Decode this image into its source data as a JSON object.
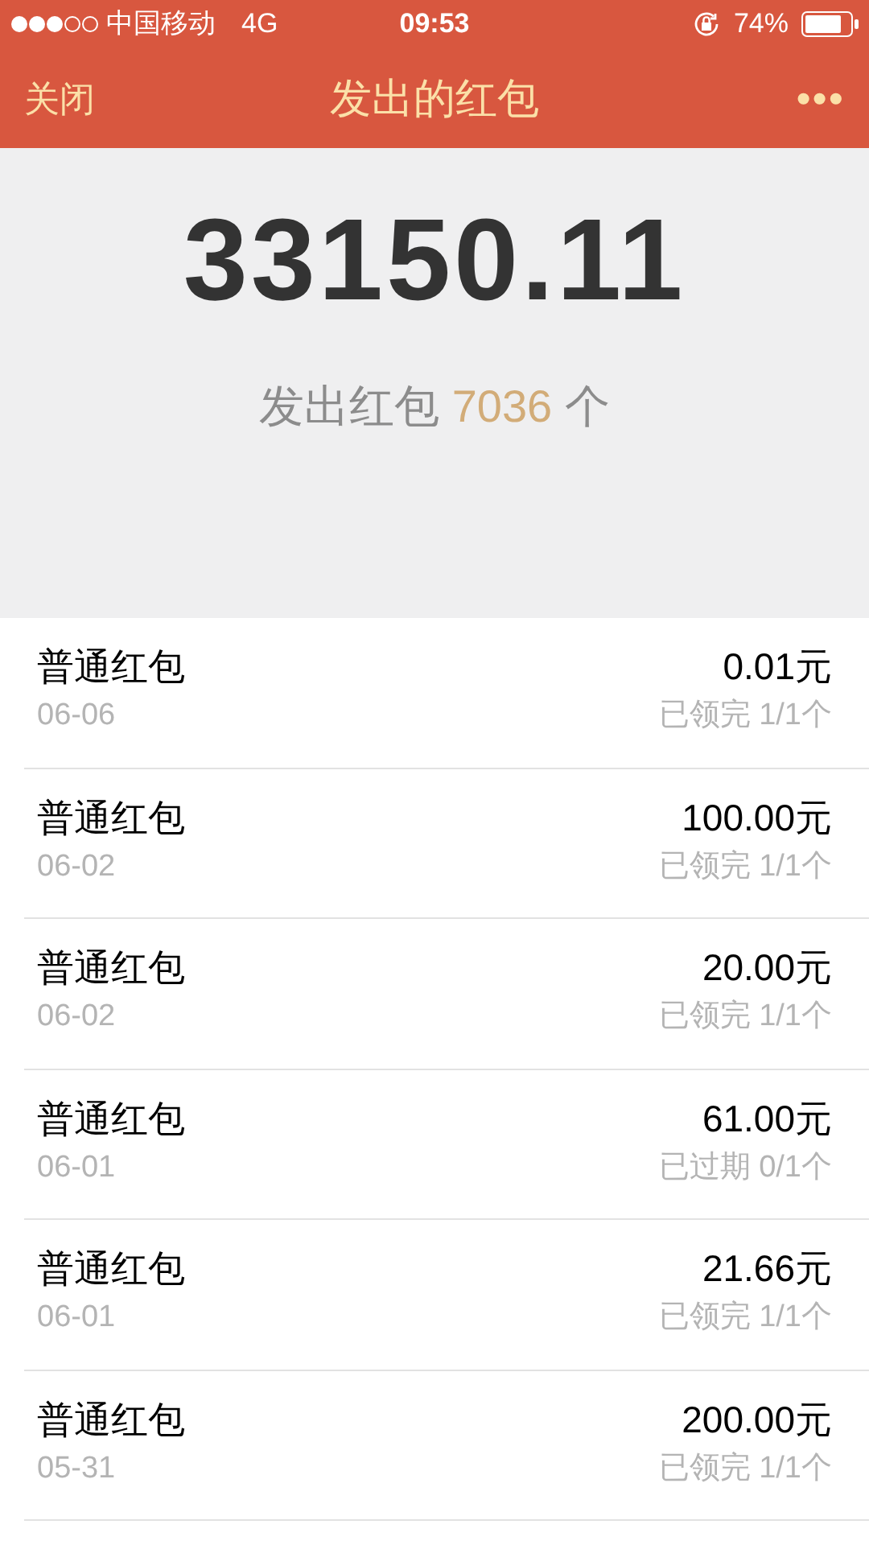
{
  "status_bar": {
    "carrier": "中国移动",
    "network": "4G",
    "time": "09:53",
    "battery": "74%"
  },
  "nav": {
    "close": "关闭",
    "title": "发出的红包",
    "more": "•••"
  },
  "summary": {
    "total": "33150.11",
    "label": "发出红包",
    "count": "7036",
    "unit": "个"
  },
  "records": [
    {
      "type": "普通红包",
      "date": "06-06",
      "amount": "0.01元",
      "status": "已领完 1/1个"
    },
    {
      "type": "普通红包",
      "date": "06-02",
      "amount": "100.00元",
      "status": "已领完 1/1个"
    },
    {
      "type": "普通红包",
      "date": "06-02",
      "amount": "20.00元",
      "status": "已领完 1/1个"
    },
    {
      "type": "普通红包",
      "date": "06-01",
      "amount": "61.00元",
      "status": "已过期 0/1个"
    },
    {
      "type": "普通红包",
      "date": "06-01",
      "amount": "21.66元",
      "status": "已领完 1/1个"
    },
    {
      "type": "普通红包",
      "date": "05-31",
      "amount": "200.00元",
      "status": "已领完 1/1个"
    }
  ]
}
